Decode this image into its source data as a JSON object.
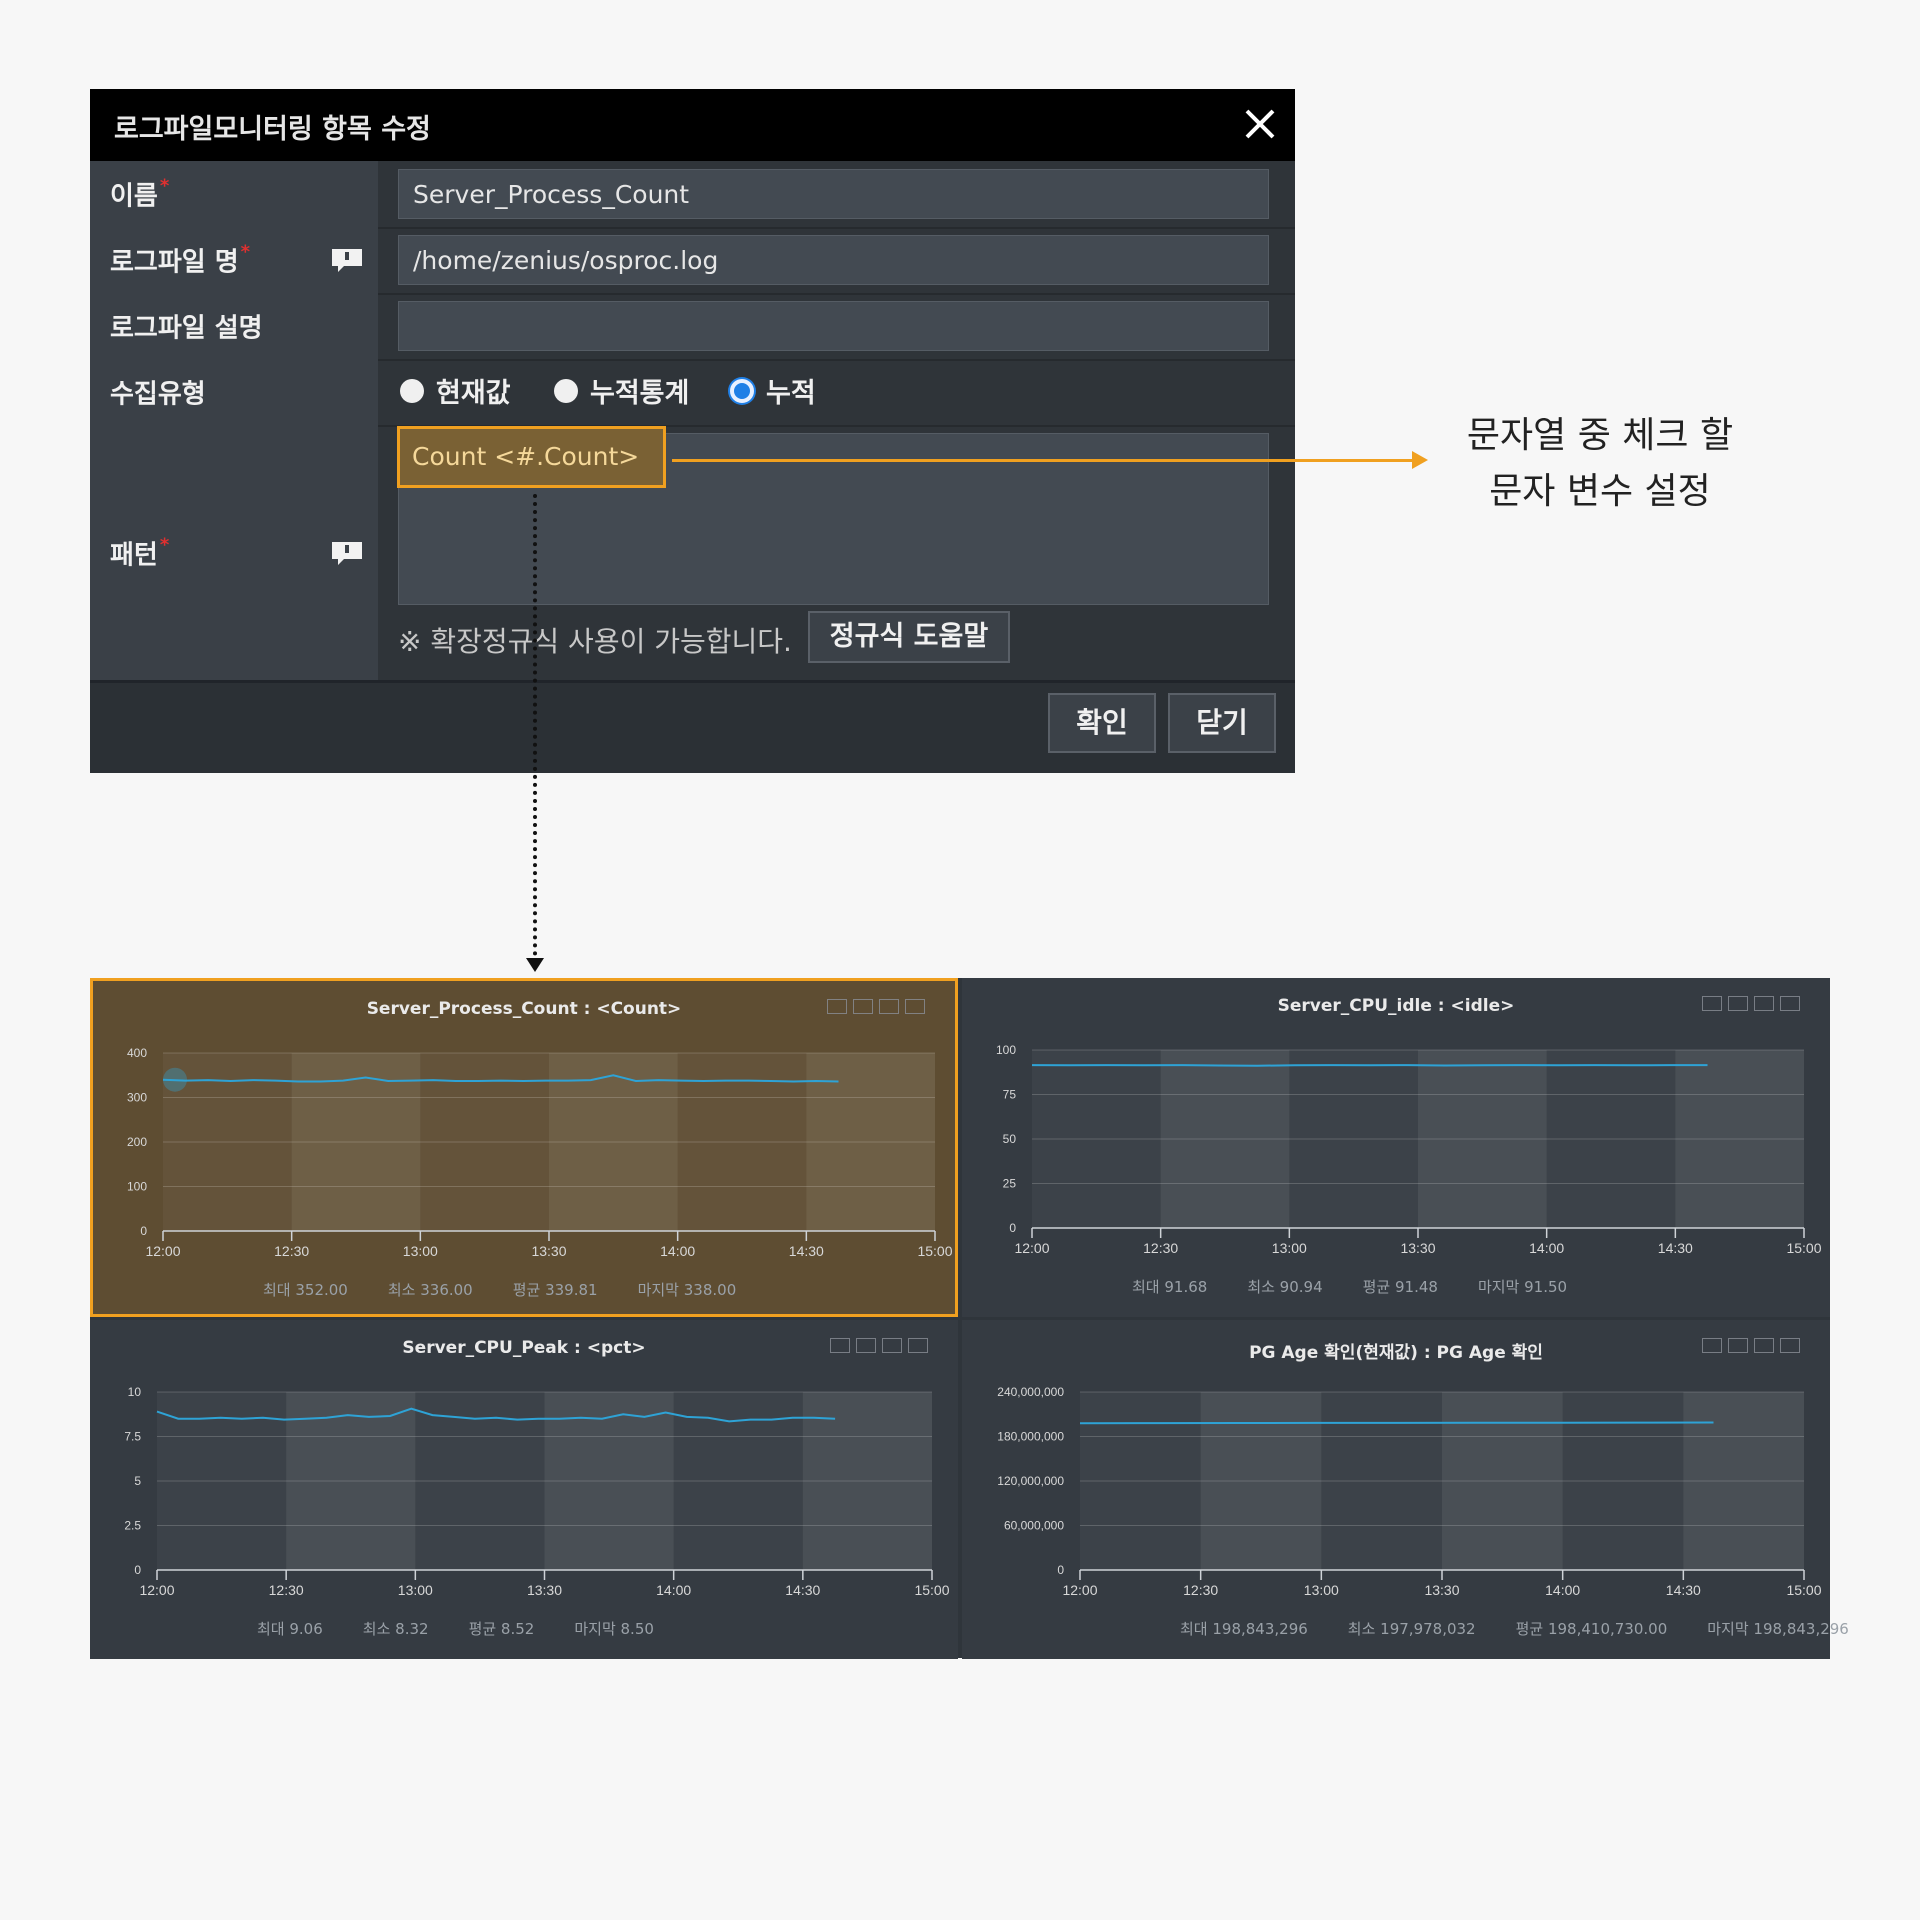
{
  "dialog": {
    "title": "로그파일모니터링 항목 수정",
    "name_label": "이름",
    "name_value": "Server_Process_Count",
    "file_label": "로그파일 명",
    "file_value": "/home/zenius/osproc.log",
    "desc_label": "로그파일 설명",
    "desc_value": "",
    "collect_label": "수집유형",
    "radio_current": "현재값",
    "radio_cum_stat": "누적통계",
    "radio_cum": "누적",
    "selected_radio": "누적",
    "pattern_label": "패턴",
    "pattern_value": "Count <#.Count>",
    "regex_note": "※ 확장정규식 사용이 가능합니다.",
    "regex_help_button": "정규식 도움말",
    "confirm_button": "확인",
    "close_button": "닫기",
    "required_mark": "*"
  },
  "annotation": {
    "line1": "문자열 중 체크 할",
    "line2": "문자 변수 설정",
    "color": "#f0a020"
  },
  "colors": {
    "accent": "#f0a020",
    "series": "#2ea3d6",
    "radio_on": "#1f7fe6"
  },
  "chart_data": [
    {
      "type": "line",
      "title": "Server_Process_Count : <Count>",
      "highlighted": true,
      "ylim": [
        0,
        400
      ],
      "y_ticks": [
        "0",
        "100",
        "200",
        "300",
        "400"
      ],
      "x_ticks": [
        "12:00",
        "12:30",
        "13:00",
        "13:30",
        "14:00",
        "14:30",
        "15:00"
      ],
      "series": [
        {
          "values": [
            340,
            338,
            339,
            337,
            339,
            338,
            336,
            336,
            338,
            345,
            337,
            338,
            339,
            337,
            337,
            338,
            337,
            338,
            338,
            339,
            350,
            337,
            339,
            338,
            337,
            338,
            338,
            337,
            336,
            337,
            336
          ]
        }
      ],
      "stats": {
        "max": "최대 352.00",
        "min": "최소 336.00",
        "avg": "평균 339.81",
        "last": "마지막 338.00"
      }
    },
    {
      "type": "line",
      "title": "Server_CPU_idle : <idle>",
      "ylim": [
        0,
        100
      ],
      "y_ticks": [
        "0",
        "25",
        "50",
        "75",
        "100"
      ],
      "x_ticks": [
        "12:00",
        "12:30",
        "13:00",
        "13:30",
        "14:00",
        "14:30",
        "15:00"
      ],
      "series": [
        {
          "values": [
            91.5,
            91.4,
            91.5,
            91.4,
            91.5,
            91.3,
            91.2,
            91.4,
            91.5,
            91.4,
            91.5,
            91.3,
            91.4,
            91.5,
            91.4,
            91.5,
            91.4,
            91.5,
            91.5
          ]
        }
      ],
      "stats": {
        "max": "최대 91.68",
        "min": "최소 90.94",
        "avg": "평균 91.48",
        "last": "마지막 91.50"
      }
    },
    {
      "type": "line",
      "title": "Server_CPU_Peak : <pct>",
      "ylim": [
        0,
        10
      ],
      "y_ticks": [
        "0",
        "2.5",
        "5",
        "7.5",
        "10"
      ],
      "x_ticks": [
        "12:00",
        "12:30",
        "13:00",
        "13:30",
        "14:00",
        "14:30",
        "15:00"
      ],
      "series": [
        {
          "values": [
            8.9,
            8.5,
            8.5,
            8.55,
            8.5,
            8.55,
            8.45,
            8.5,
            8.55,
            8.7,
            8.6,
            8.65,
            9.06,
            8.7,
            8.6,
            8.5,
            8.55,
            8.45,
            8.5,
            8.5,
            8.55,
            8.5,
            8.75,
            8.6,
            8.85,
            8.6,
            8.55,
            8.35,
            8.45,
            8.45,
            8.55,
            8.55,
            8.5
          ]
        }
      ],
      "stats": {
        "max": "최대 9.06",
        "min": "최소 8.32",
        "avg": "평균 8.52",
        "last": "마지막 8.50"
      }
    },
    {
      "type": "line",
      "title": "PG Age 확인(현재값) : PG Age 확인",
      "ylim": [
        0,
        240000000
      ],
      "y_ticks": [
        "0",
        "60,000,000",
        "120,000,000",
        "180,000,000",
        "240,000,000"
      ],
      "x_ticks": [
        "12:00",
        "12:30",
        "13:00",
        "13:30",
        "14:00",
        "14:30",
        "15:00"
      ],
      "series": [
        {
          "values": [
            198000000,
            198100000,
            198200000,
            198300000,
            198400000,
            198500000,
            198600000,
            198700000,
            198843296
          ]
        }
      ],
      "stats": {
        "max": "최대 198,843,296",
        "min": "최소 197,978,032",
        "avg": "평균 198,410,730.00",
        "last": "마지막 198,843,296"
      }
    }
  ]
}
